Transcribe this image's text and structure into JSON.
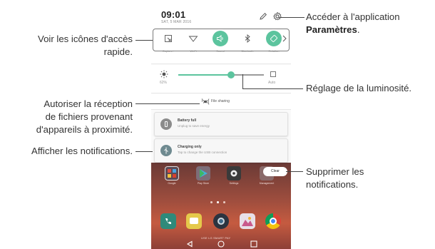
{
  "phone": {
    "time": "09:01",
    "date": "SAT, 5 MAR 2016",
    "quick_settings": [
      {
        "label": "Capture+",
        "icon": "capture-plus-icon",
        "active": false
      },
      {
        "label": "Wi-Fi",
        "icon": "wifi-icon",
        "active": false
      },
      {
        "label": "Sound",
        "icon": "sound-icon",
        "active": true
      },
      {
        "label": "Bluetooth",
        "icon": "bluetooth-icon",
        "active": false
      },
      {
        "label": "Rotation",
        "icon": "rotation-icon",
        "active": true
      }
    ],
    "brightness": {
      "percent_label": "62%",
      "auto_label": "Auto",
      "level": 0.62
    },
    "file_sharing": "File sharing",
    "notifications": [
      {
        "title": "Battery full",
        "subtitle": "Unplug to save energy",
        "icon": "battery-icon"
      },
      {
        "title": "Charging only",
        "subtitle": "Tap to change the USB connection",
        "icon": "usb-icon"
      }
    ],
    "clear_label": "Clear",
    "home_apps": [
      {
        "label": "Google",
        "icon": "google-folder-icon"
      },
      {
        "label": "Play Store",
        "icon": "play-store-icon"
      },
      {
        "label": "Settings",
        "icon": "settings-app-icon"
      },
      {
        "label": "Management",
        "icon": "management-folder-icon"
      }
    ],
    "home_caption": "USE LG SMART PAY",
    "accent_color": "#5cc49e"
  },
  "callouts": {
    "settings_line1": "Accéder à l'application",
    "settings_bold": "Paramètres",
    "settings_end": ".",
    "quick_access": [
      "Voir les icônes d'accès",
      "rapide."
    ],
    "brightness": "Réglage de la luminosité.",
    "file_sharing": [
      "Autoriser la réception",
      "de fichiers provenant",
      "d'appareils à proximité."
    ],
    "notifications": "Afficher les notifications.",
    "clear": [
      "Supprimer les",
      "notifications."
    ]
  }
}
